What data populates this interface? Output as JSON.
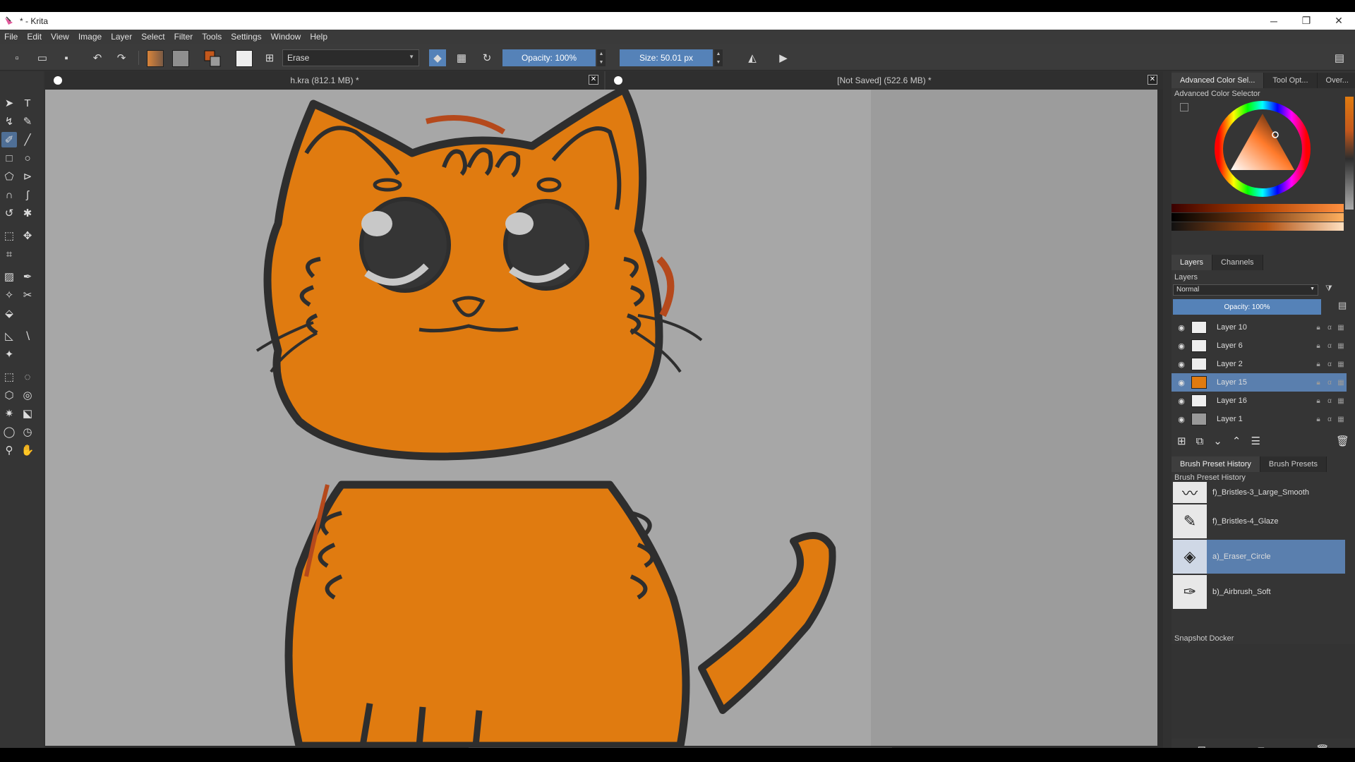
{
  "window": {
    "title": "* - Krita",
    "min": "─",
    "max": "❐",
    "close": "✕"
  },
  "menu": [
    "File",
    "Edit",
    "View",
    "Image",
    "Layer",
    "Select",
    "Filter",
    "Tools",
    "Settings",
    "Window",
    "Help"
  ],
  "toolbar": {
    "preset_name": "Erase",
    "opacity_label": "Opacity: 100%",
    "size_label": "Size: 50.01 px",
    "foreground_color": "#c4581c",
    "background_color": "#9a9a9a"
  },
  "documents": [
    {
      "title": "h.kra (812.1 MB) *"
    },
    {
      "title": "[Not Saved]  (522.6 MB) *"
    }
  ],
  "dockers": {
    "top_tabs": [
      "Advanced Color Sel...",
      "Tool Opt...",
      "Over..."
    ],
    "color_selector_title": "Advanced Color Selector",
    "layers_tabs": [
      "Layers",
      "Channels"
    ],
    "layers_title": "Layers",
    "blend_mode": "Normal",
    "layer_opacity": "Opacity:  100%",
    "layers": [
      {
        "name": "Layer 10",
        "selected": false
      },
      {
        "name": "Layer 6",
        "selected": false
      },
      {
        "name": "Layer 2",
        "selected": false
      },
      {
        "name": "Layer 15",
        "selected": true
      },
      {
        "name": "Layer 16",
        "selected": false
      },
      {
        "name": "Layer 1",
        "selected": false
      }
    ],
    "brush_tabs": [
      "Brush Preset History",
      "Brush Presets"
    ],
    "brush_history_title": "Brush Preset History",
    "brushes": [
      {
        "name": "f)_Bristles-3_Large_Smooth",
        "selected": false
      },
      {
        "name": "f)_Bristles-4_Glaze",
        "selected": false
      },
      {
        "name": "a)_Eraser_Circle",
        "selected": true
      },
      {
        "name": "b)_Airbrush_Soft",
        "selected": false
      }
    ],
    "snapshot_title": "Snapshot Docker"
  },
  "canvas": {
    "cat_fill": "#e07b10",
    "outline": "#2e2e2e",
    "background": "#a7a7a7",
    "accent_brown": "#b5491c"
  }
}
